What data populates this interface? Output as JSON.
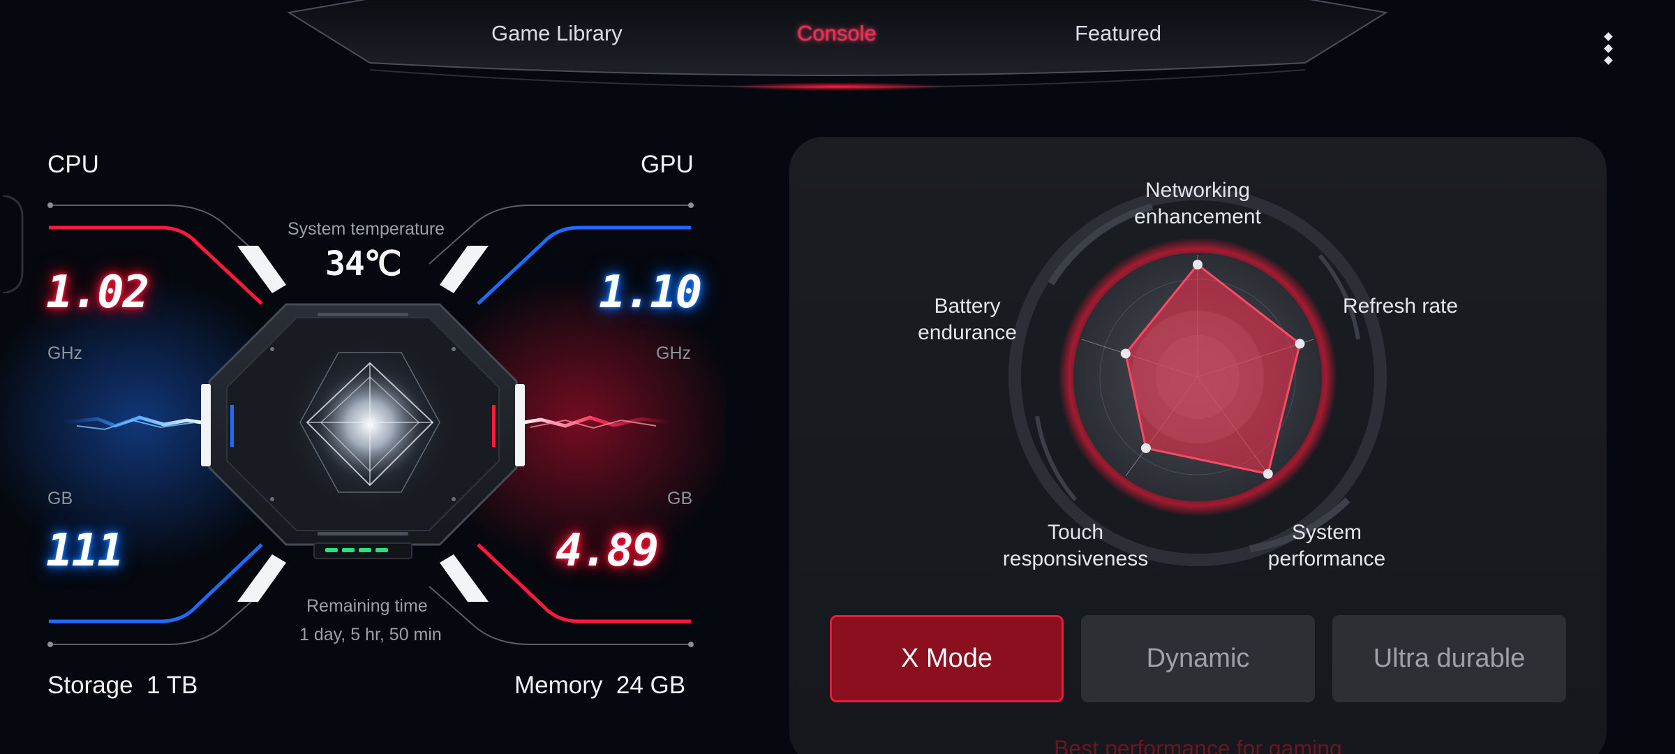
{
  "nav": {
    "tabs": [
      {
        "label": "Game Library",
        "active": false
      },
      {
        "label": "Console",
        "active": true
      },
      {
        "label": "Featured",
        "active": false
      }
    ],
    "more_icon": "vertical-dots-icon",
    "accent_color": "#ff2a52"
  },
  "monitor": {
    "cpu": {
      "label": "CPU",
      "value": "1.02",
      "unit": "GHz"
    },
    "gpu": {
      "label": "GPU",
      "value": "1.10",
      "unit": "GHz"
    },
    "temperature": {
      "label": "System temperature",
      "value": "34℃"
    },
    "storage_free": {
      "value": "111",
      "unit": "GB"
    },
    "memory_free": {
      "value": "4.89",
      "unit": "GB"
    },
    "remaining": {
      "label": "Remaining time",
      "value": "1 day, 5 hr, 50 min"
    },
    "storage": {
      "label": "Storage",
      "value": "1 TB"
    },
    "memory": {
      "label": "Memory",
      "value": "24 GB"
    },
    "colors": {
      "cpu": "#ff1a3c",
      "gpu": "#1a6dff"
    }
  },
  "performance": {
    "axes": [
      {
        "label": "Networking enhancement",
        "value": 0.92
      },
      {
        "label": "Refresh rate",
        "value": 0.88
      },
      {
        "label": "System performance",
        "value": 0.98
      },
      {
        "label": "Touch responsiveness",
        "value": 0.72
      },
      {
        "label": "Battery endurance",
        "value": 0.62
      }
    ],
    "modes": [
      {
        "label": "X Mode",
        "selected": true
      },
      {
        "label": "Dynamic",
        "selected": false
      },
      {
        "label": "Ultra durable",
        "selected": false
      }
    ],
    "description": "Best performance for gaming"
  }
}
